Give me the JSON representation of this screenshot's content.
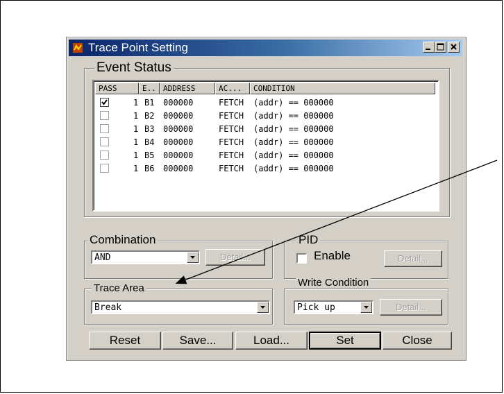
{
  "window": {
    "title": "Trace Point Setting",
    "app_icon": "app-icon",
    "controls": [
      "minimize-icon",
      "maximize-icon",
      "close-icon"
    ]
  },
  "event_status": {
    "legend": "Event Status",
    "columns": [
      "PASS",
      "E..",
      "ADDRESS",
      "AC...",
      "CONDITION"
    ],
    "rows": [
      {
        "checked": true,
        "pass": "1",
        "event": "B1",
        "address": "000000",
        "access": "FETCH",
        "condition": "(addr) == 000000"
      },
      {
        "checked": false,
        "pass": "1",
        "event": "B2",
        "address": "000000",
        "access": "FETCH",
        "condition": "(addr) == 000000"
      },
      {
        "checked": false,
        "pass": "1",
        "event": "B3",
        "address": "000000",
        "access": "FETCH",
        "condition": "(addr) == 000000"
      },
      {
        "checked": false,
        "pass": "1",
        "event": "B4",
        "address": "000000",
        "access": "FETCH",
        "condition": "(addr) == 000000"
      },
      {
        "checked": false,
        "pass": "1",
        "event": "B5",
        "address": "000000",
        "access": "FETCH",
        "condition": "(addr) == 000000"
      },
      {
        "checked": false,
        "pass": "1",
        "event": "B6",
        "address": "000000",
        "access": "FETCH",
        "condition": "(addr) == 000000"
      }
    ]
  },
  "combination": {
    "legend": "Combination",
    "value": "AND",
    "detail_label": "Detail..."
  },
  "pid": {
    "legend": "PID",
    "enable_label": "Enable",
    "enabled": false,
    "detail_label": "Detail..."
  },
  "trace_area": {
    "legend": "Trace Area",
    "value": "Break"
  },
  "write_condition": {
    "legend": "Write Condition",
    "value": "Pick up",
    "detail_label": "Detail..."
  },
  "buttons": {
    "reset": "Reset",
    "save": "Save...",
    "load": "Load...",
    "set": "Set",
    "close": "Close"
  },
  "colors": {
    "title_start": "#0a246a",
    "title_end": "#a6caf0",
    "face": "#d4d0c8",
    "annotation": "#000000"
  }
}
